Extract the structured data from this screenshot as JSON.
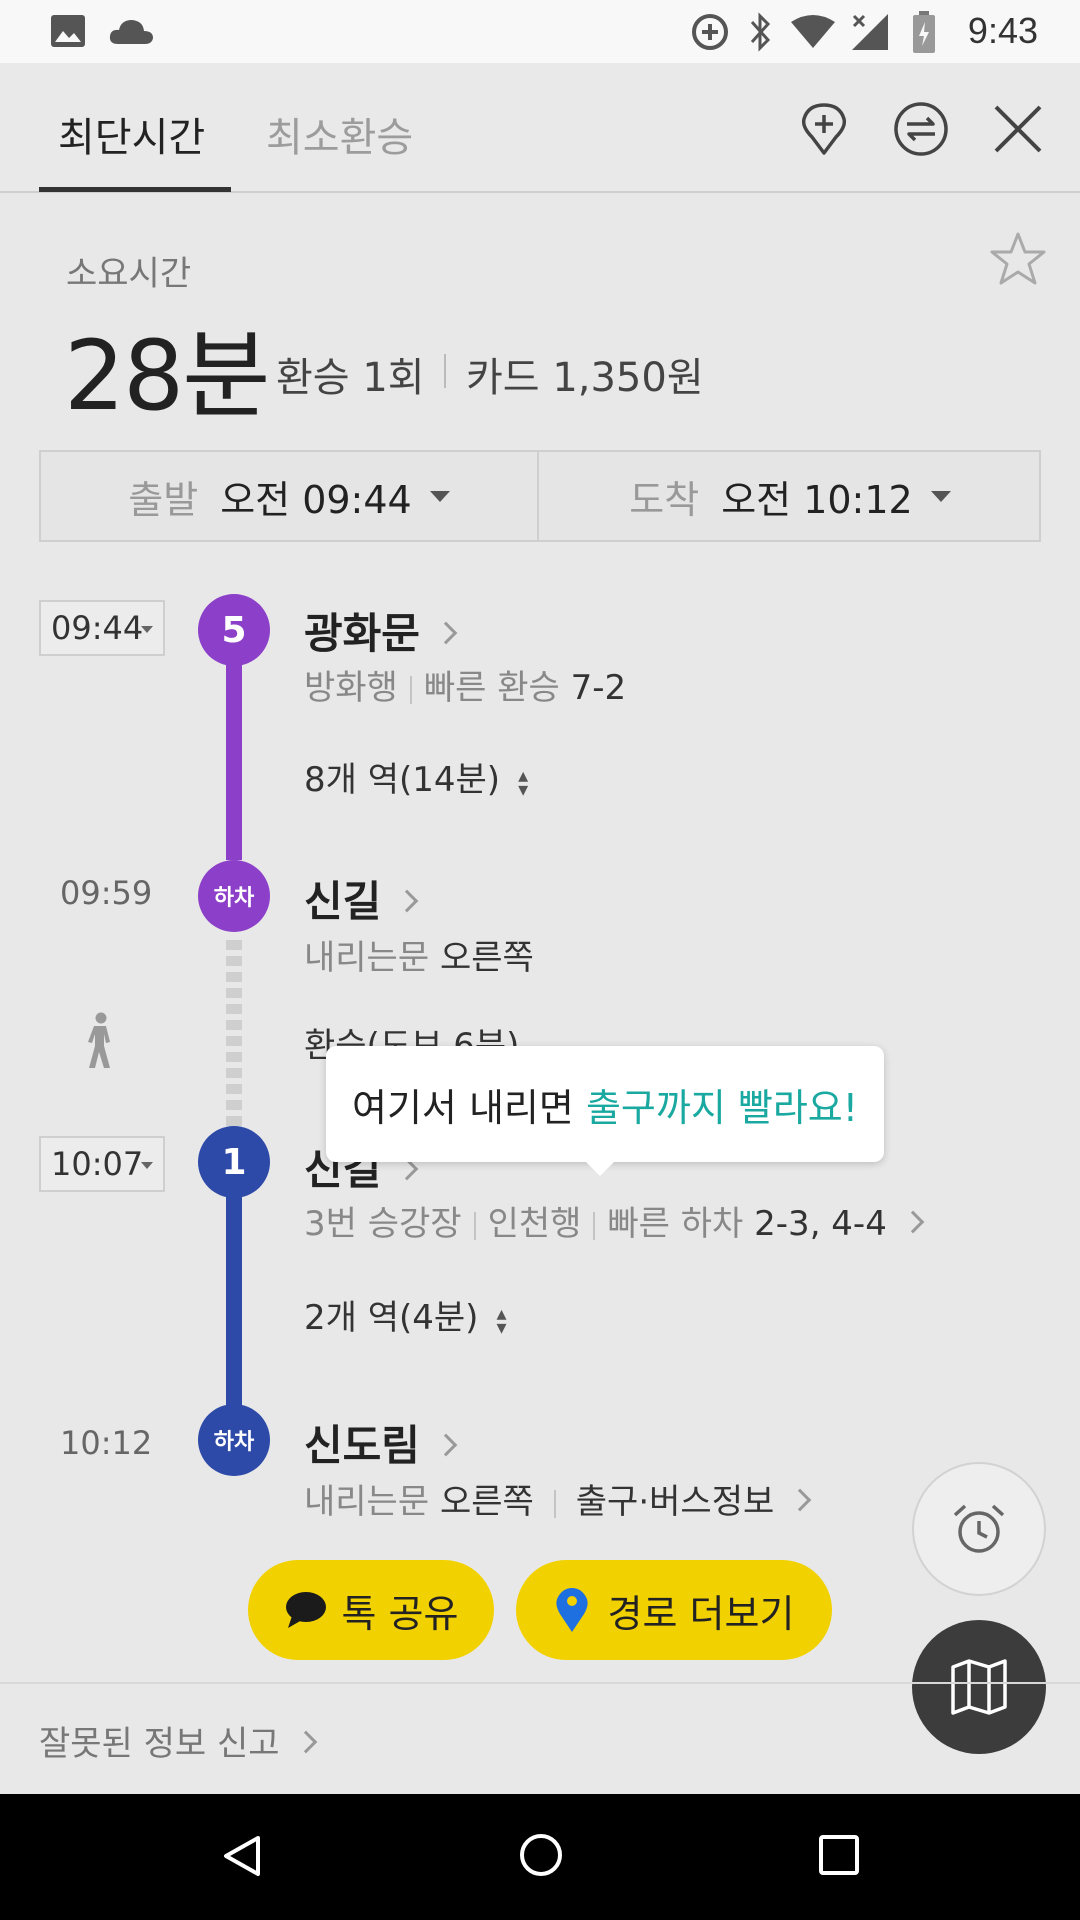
{
  "status_bar": {
    "time": "9:43"
  },
  "tabs": [
    {
      "label": "최단시간"
    },
    {
      "label": "최소환승"
    }
  ],
  "summary": {
    "label": "소요시간",
    "duration": "28분",
    "transfer": "환승 1회",
    "fare": "카드 1,350원"
  },
  "time_bar": {
    "depart_label": "출발",
    "depart_value": "오전 09:44",
    "arrive_label": "도착",
    "arrive_value": "오전 10:12"
  },
  "route": {
    "leg1": {
      "time": "09:44",
      "line_badge": "5",
      "line_color": "#8c3fc8",
      "station": "광화문",
      "direction": "방화행",
      "fast_label": "빠른 환승",
      "fast_value": "7-2",
      "stops": "8개 역(14분)"
    },
    "alight1": {
      "time": "09:59",
      "badge": "하차",
      "station": "신길",
      "door_label": "내리는문",
      "door_value": "오른쪽"
    },
    "walk": {
      "text": "환승(도보 6분)"
    },
    "leg2": {
      "time": "10:07",
      "line_badge": "1",
      "line_color": "#2e4aa8",
      "station": "신길",
      "platform": "3번 승강장",
      "direction": "인천행",
      "fast_label": "빠른 하차",
      "fast_value": "2-3, 4-4",
      "stops": "2개 역(4분)"
    },
    "alight2": {
      "time": "10:12",
      "badge": "하차",
      "station": "신도림",
      "door_label": "내리는문",
      "door_value": "오른쪽",
      "exit_info": "출구·버스정보"
    }
  },
  "tooltip": {
    "prefix": "여기서 내리면 ",
    "highlight": "출구까지 빨라요!"
  },
  "buttons": {
    "share": "톡 공유",
    "more_routes": "경로 더보기"
  },
  "report": "잘못된 정보 신고",
  "colors": {
    "accent_yellow": "#f2d100",
    "tooltip_teal": "#1aa9a0"
  }
}
